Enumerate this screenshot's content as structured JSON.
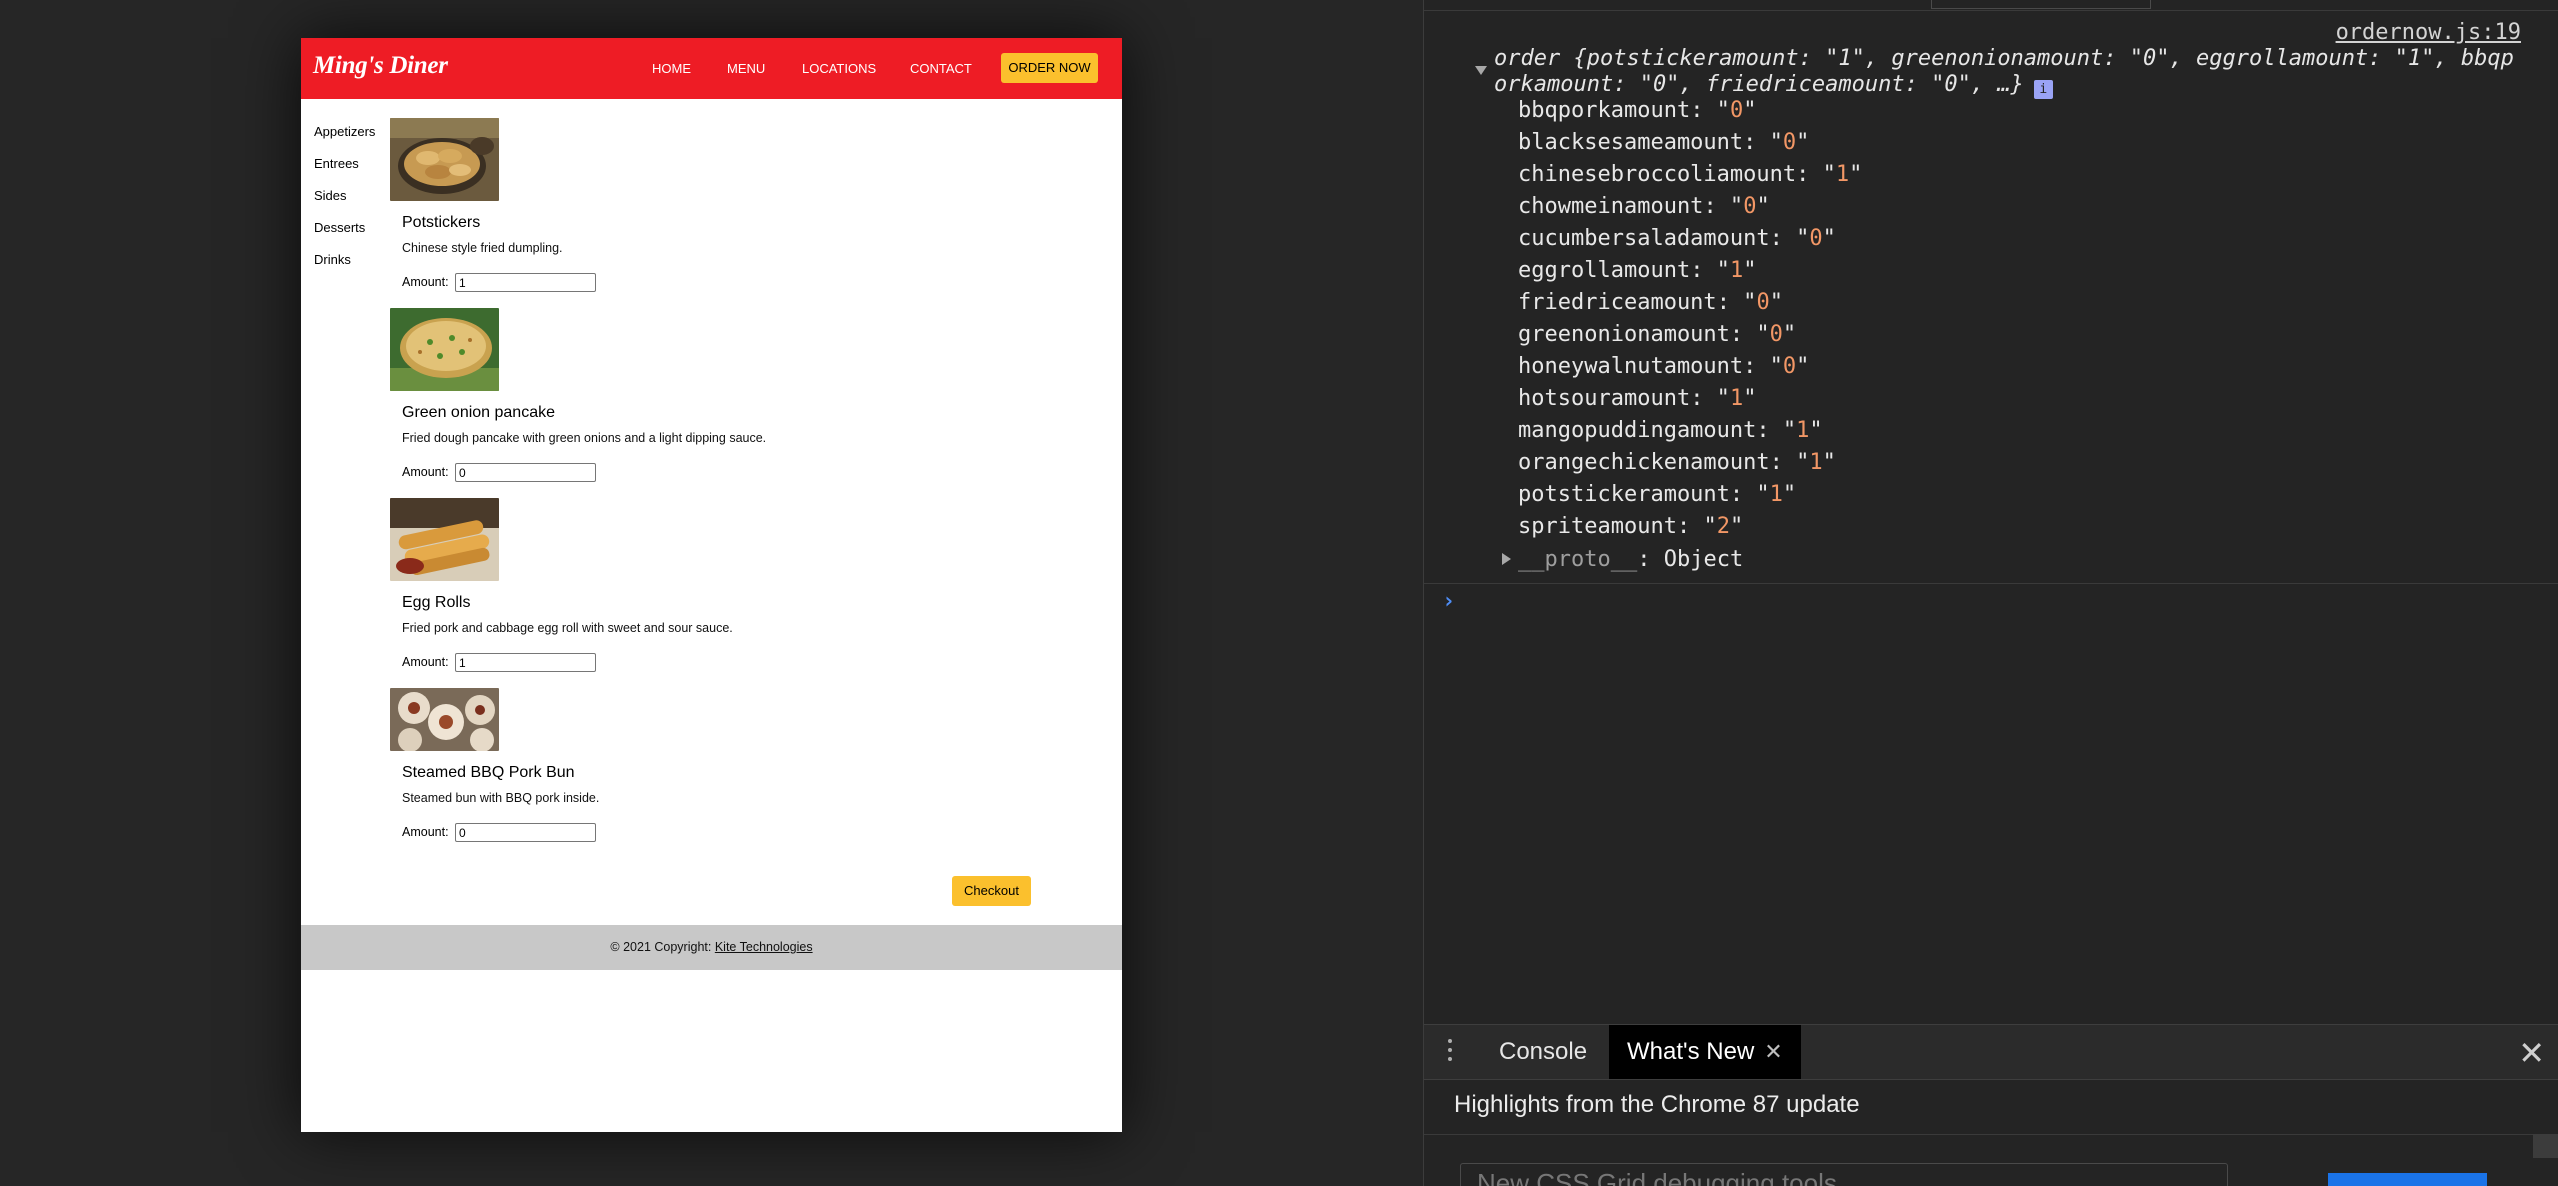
{
  "site": {
    "brand": "Ming's Diner",
    "nav": [
      {
        "label": "HOME"
      },
      {
        "label": "MENU"
      },
      {
        "label": "LOCATIONS"
      },
      {
        "label": "CONTACT"
      }
    ],
    "order_now_label": "ORDER NOW",
    "categories": [
      {
        "label": "Appetizers"
      },
      {
        "label": "Entrees"
      },
      {
        "label": "Sides"
      },
      {
        "label": "Desserts"
      },
      {
        "label": "Drinks"
      }
    ],
    "amount_label": "Amount:",
    "items": [
      {
        "name": "Potstickers",
        "description": "Chinese style fried dumpling.",
        "amount": "1"
      },
      {
        "name": "Green onion pancake",
        "description": "Fried dough pancake with green onions and a light dipping sauce.",
        "amount": "0"
      },
      {
        "name": "Egg Rolls",
        "description": "Fried pork and cabbage egg roll with sweet and sour sauce.",
        "amount": "1"
      },
      {
        "name": "Steamed BBQ Pork Bun",
        "description": "Steamed bun with BBQ pork inside.",
        "amount": "0"
      }
    ],
    "checkout_label": "Checkout",
    "footer": {
      "copyright": "© 2021 Copyright: ",
      "company": "Kite Technologies"
    },
    "colors": {
      "header_red": "#ee1c25",
      "button_yellow": "#fbc02d",
      "footer_gray": "#c8c8c8"
    }
  },
  "devtools": {
    "source_link": "ordernow.js:19",
    "object_summary_line1": "order {potstickeramount: \"1\", greenonionamount: \"0\", eggrollamount: \"1\", bbqp",
    "object_summary_line2": "orkamount: \"0\", friedriceamount: \"0\", …}",
    "info_badge": "i",
    "properties": [
      {
        "key": "bbqporkamount",
        "value": "0"
      },
      {
        "key": "blacksesameamount",
        "value": "0"
      },
      {
        "key": "chinesebroccoliamount",
        "value": "1"
      },
      {
        "key": "chowmeinamount",
        "value": "0"
      },
      {
        "key": "cucumbersaladamount",
        "value": "0"
      },
      {
        "key": "eggrollamount",
        "value": "1"
      },
      {
        "key": "friedriceamount",
        "value": "0"
      },
      {
        "key": "greenonionamount",
        "value": "0"
      },
      {
        "key": "honeywalnutamount",
        "value": "0"
      },
      {
        "key": "hotsouramount",
        "value": "1"
      },
      {
        "key": "mangopuddingamount",
        "value": "1"
      },
      {
        "key": "orangechickenamount",
        "value": "1"
      },
      {
        "key": "potstickeramount",
        "value": "1"
      },
      {
        "key": "spriteamount",
        "value": "2"
      }
    ],
    "proto_key": "__proto__",
    "proto_value": "Object",
    "prompt": "›",
    "drawer_tabs": [
      {
        "label": "Console"
      },
      {
        "label": "What's New"
      }
    ],
    "whats_new_title": "Highlights from the Chrome 87 update",
    "whats_new_card": "New CSS Grid debugging tools",
    "colors": {
      "property_value": "#f29766",
      "prompt_blue": "#4f8ef7"
    }
  }
}
